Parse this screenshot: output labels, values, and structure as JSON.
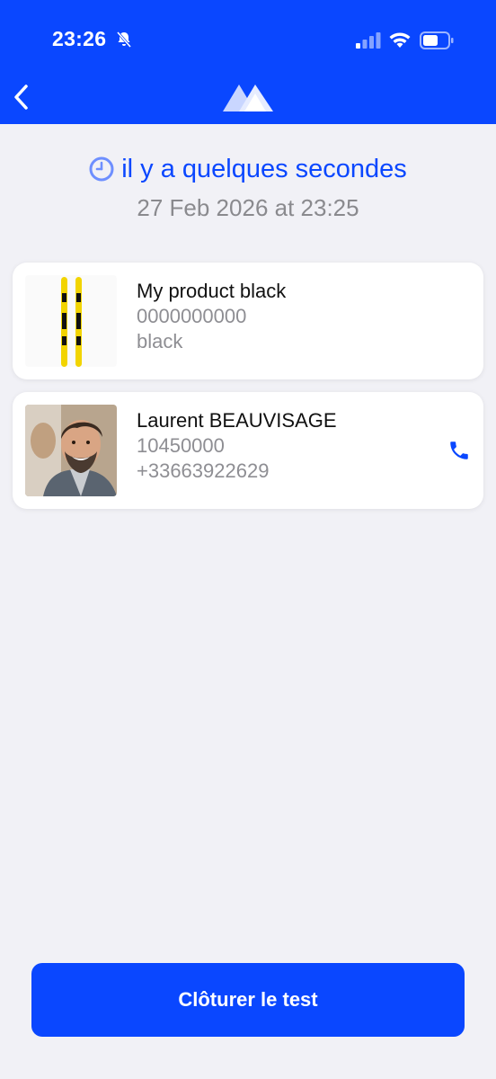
{
  "status_bar": {
    "time": "23:26",
    "icons": [
      "bell-slash-icon",
      "cellular-signal-icon",
      "wifi-icon",
      "battery-icon"
    ]
  },
  "nav": {
    "back_icon": "chevron-left-icon",
    "logo_icon": "mountain-logo-icon"
  },
  "timestamp": {
    "relative": "il y a quelques secondes",
    "absolute": "27 Feb 2026 at 23:25",
    "icon": "clock-icon"
  },
  "product_card": {
    "name": "My product black",
    "code": "0000000000",
    "color": "black",
    "image_icon": "skis-image"
  },
  "customer_card": {
    "name": "Laurent BEAUVISAGE",
    "id": "10450000",
    "phone": "+33663922629",
    "image_icon": "avatar-photo",
    "action_icon": "phone-icon"
  },
  "actions": {
    "close_test_label": "Clôturer le test"
  },
  "colors": {
    "brand": "#0a47ff",
    "background": "#f1f1f6",
    "muted_text": "#8e8e93"
  }
}
